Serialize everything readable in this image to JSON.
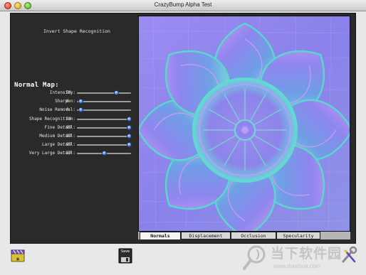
{
  "window": {
    "title": "CrazyBump Alpha Test"
  },
  "controls": {
    "invert_label": "Invert Shape Recognition",
    "section_title": "Normal Map:",
    "sliders": [
      {
        "label": "Intensity:",
        "value": "50",
        "fraction": 0.72
      },
      {
        "label": "Sharpen:",
        "value": "0",
        "fraction": 0.06
      },
      {
        "label": "Noise Removal:",
        "value": "0",
        "fraction": 0.06
      },
      {
        "label": "Shape Recognition:",
        "value": "99",
        "fraction": 0.96
      },
      {
        "label": "Fine Detail:",
        "value": "99",
        "fraction": 0.96
      },
      {
        "label": "Medium Detail:",
        "value": "99",
        "fraction": 0.96
      },
      {
        "label": "Large Detail:",
        "value": "99",
        "fraction": 0.96
      },
      {
        "label": "Very Large Detail:",
        "value": "50",
        "fraction": 0.5
      }
    ]
  },
  "tabs": [
    {
      "label": "Normals",
      "active": true
    },
    {
      "label": "Displacement",
      "active": false
    },
    {
      "label": "Occlusion",
      "active": false
    },
    {
      "label": "Specularity",
      "active": false
    }
  ],
  "dock": {
    "save_label": "Save"
  },
  "watermark": {
    "brand": "当下软件园",
    "url": "www.downxia.com"
  },
  "colors": {
    "accent": "#3f7fd6",
    "panel_bg": "#2a2a2a",
    "normal_map_base": "#8a7fe8"
  },
  "icons": {
    "dock_left": "clapper-board-icon",
    "save": "floppy-disk-icon",
    "tools": "wrench-screwdriver-icon",
    "watermark_logo": "magnifier-logo-icon"
  }
}
